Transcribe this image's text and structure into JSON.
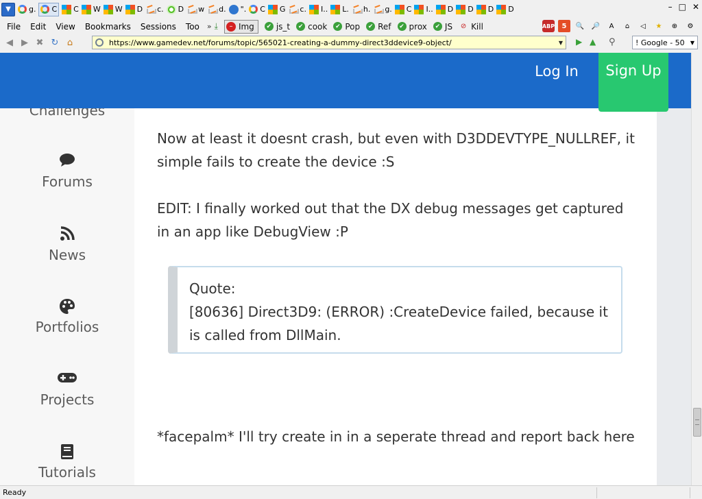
{
  "browser": {
    "tabs": [
      {
        "icon": "google",
        "label": "g."
      },
      {
        "icon": "google",
        "label": "C",
        "active": true
      },
      {
        "icon": "windows",
        "label": "C"
      },
      {
        "icon": "windows",
        "label": "W"
      },
      {
        "icon": "windows",
        "label": "W"
      },
      {
        "icon": "windows",
        "label": "D"
      },
      {
        "icon": "stackoverflow",
        "label": "c."
      },
      {
        "icon": "spinner",
        "label": "D"
      },
      {
        "icon": "stackoverflow",
        "label": "w"
      },
      {
        "icon": "stackoverflow",
        "label": "d."
      },
      {
        "icon": "gamedev",
        "label": "\"."
      },
      {
        "icon": "google",
        "label": "C"
      },
      {
        "icon": "windows",
        "label": "G"
      },
      {
        "icon": "stackoverflow",
        "label": "c."
      },
      {
        "icon": "windows",
        "label": "I.."
      },
      {
        "icon": "windows",
        "label": "L."
      },
      {
        "icon": "stackoverflow",
        "label": "h."
      },
      {
        "icon": "stackoverflow",
        "label": "g."
      },
      {
        "icon": "windows",
        "label": "C"
      },
      {
        "icon": "windows",
        "label": "I.."
      },
      {
        "icon": "windows",
        "label": "D"
      },
      {
        "icon": "windows",
        "label": "D"
      },
      {
        "icon": "windows",
        "label": "D"
      },
      {
        "icon": "windows",
        "label": "D"
      }
    ],
    "menu": [
      "File",
      "Edit",
      "View",
      "Bookmarks",
      "Sessions",
      "Too"
    ],
    "toolbar_buttons": [
      {
        "label": "Img",
        "icon": "stop"
      },
      {
        "label": "js_t",
        "icon": "check"
      },
      {
        "label": "cook",
        "icon": "check"
      },
      {
        "label": "Pop",
        "icon": "check"
      },
      {
        "label": "Ref",
        "icon": "check"
      },
      {
        "label": "prox",
        "icon": "check"
      },
      {
        "label": "JS",
        "icon": "check"
      },
      {
        "label": "Kill",
        "icon": "kill"
      }
    ],
    "url": "https://www.gamedev.net/forums/topic/565021-creating-a-dummy-direct3ddevice9-object/",
    "search_engine": "! Google - 50",
    "status": "Ready"
  },
  "header": {
    "login": "Log In",
    "signup": "Sign Up"
  },
  "sidebar": {
    "items": [
      {
        "label": "Challenges",
        "icon": "trophy-icon"
      },
      {
        "label": "Forums",
        "icon": "comment-icon"
      },
      {
        "label": "News",
        "icon": "rss-icon"
      },
      {
        "label": "Portfolios",
        "icon": "palette-icon"
      },
      {
        "label": "Projects",
        "icon": "gamepad-icon"
      },
      {
        "label": "Tutorials",
        "icon": "book-icon"
      }
    ]
  },
  "post": {
    "para1": "Now at least it doesnt crash, but even with D3DDEVTYPE_NULLREF, it simple fails to create the device :S",
    "para2": "EDIT: I finally worked out that the DX debug messages get captured in an app like DebugView :P",
    "quote_label": "Quote:",
    "quote_text": "[80636] Direct3D9: (ERROR) :CreateDevice failed, because it is called from DllMain.",
    "para3": "*facepalm* I'll try create in in a seperate thread and report back here"
  },
  "colors": {
    "header_blue": "#1b6ac9",
    "signup_green": "#28c870",
    "quote_border": "#c5dcec"
  }
}
